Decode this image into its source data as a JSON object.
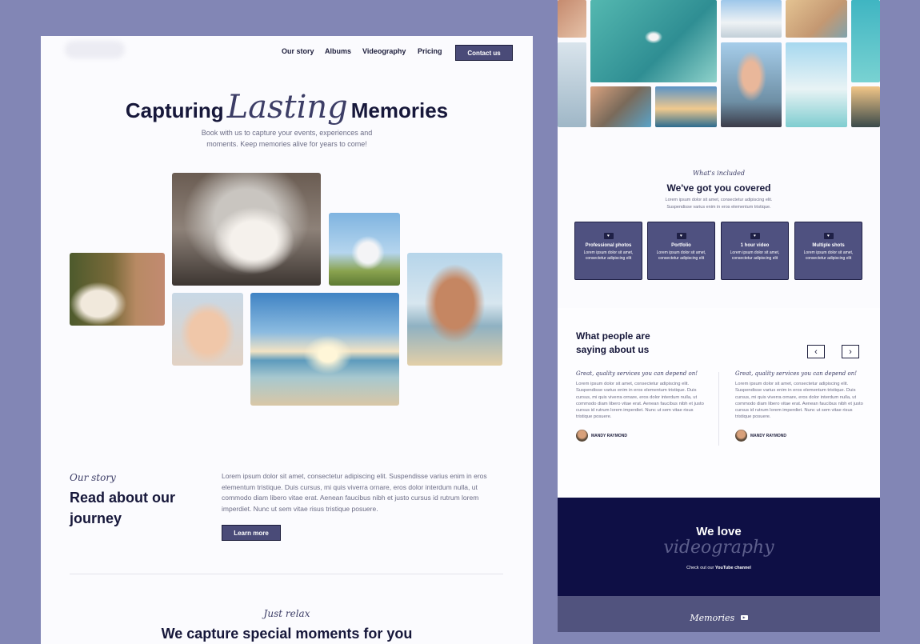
{
  "nav": {
    "items": [
      "Our story",
      "Albums",
      "Videography",
      "Pricing"
    ],
    "contact_label": "Contact us"
  },
  "hero": {
    "title_before": "Capturing",
    "title_script": "Lasting",
    "title_after": "Memories",
    "subtitle": "Book with us to capture your events, experiences and moments. Keep memories alive for years to come!"
  },
  "story": {
    "eyebrow": "Our story",
    "heading": "Read about our journey",
    "body": "Lorem ipsum dolor sit amet, consectetur adipiscing elit. Suspendisse varius enim in eros elementum tristique. Duis cursus, mi quis viverra ornare, eros dolor interdum nulla, ut commodo diam libero vitae erat. Aenean faucibus nibh et justo cursus id rutrum lorem imperdiet. Nunc ut sem vitae risus tristique posuere.",
    "button": "Learn more"
  },
  "relax": {
    "eyebrow": "Just relax",
    "heading": "We capture special moments for you"
  },
  "included": {
    "eyebrow": "What's included",
    "heading": "We've got you covered",
    "subtitle": "Lorem ipsum dolor sit amet, consectetur adipiscing elit. Suspendisse varius enim in eros elementum tristique.",
    "cards": [
      {
        "title": "Professional photos",
        "desc": "Lorem ipsum dolor sit amet, consectetur adipiscing elit",
        "icon": "heart-icon"
      },
      {
        "title": "Portfolio",
        "desc": "Lorem ipsum dolor sit amet, consectetur adipiscing elit",
        "icon": "heart-icon"
      },
      {
        "title": "1 hour video",
        "desc": "Lorem ipsum dolor sit amet, consectetur adipiscing elit",
        "icon": "heart-icon"
      },
      {
        "title": "Multiple shots",
        "desc": "Lorem ipsum dolor sit amet, consectetur adipiscing elit",
        "icon": "heart-icon"
      }
    ]
  },
  "testimonials": {
    "heading": "What people are saying about us",
    "prev_icon": "chevron-left-icon",
    "next_icon": "chevron-right-icon",
    "items": [
      {
        "quote_title": "Great, quality services you can depend on!",
        "body": "Lorem ipsum dolor sit amet, consectetur adipiscing elit. Suspendisse varius enim in eros elementum tristique. Duis cursus, mi quis viverra ornare, eros dolor interdum nulla, ut commodo diam libero vitae erat. Aenean faucibus nibh et justo cursus id rutrum lorem imperdiet. Nunc ut sem vitae risus tristique posuere.",
        "author": "MANDY RAYMOND"
      },
      {
        "quote_title": "Great, quality services you can depend on!",
        "body": "Lorem ipsum dolor sit amet, consectetur adipiscing elit. Suspendisse varius enim in eros elementum tristique. Duis cursus, mi quis viverra ornare, eros dolor interdum nulla, ut commodo diam libero vitae erat. Aenean faucibus nibh et justo cursus id rutrum lorem imperdiet. Nunc ut sem vitae risus tristique posuere.",
        "author": "MANDY RAYMOND"
      }
    ]
  },
  "video": {
    "heading": "We love",
    "script": "videography",
    "caption_prefix": "Check out our",
    "caption_link": "YouTube channel"
  },
  "memories": {
    "label": "Memories",
    "icon": "youtube-icon"
  },
  "colors": {
    "background": "#8286b5",
    "accent": "#4f5180",
    "navy": "#0e0f45",
    "text_dark": "#16173a"
  }
}
